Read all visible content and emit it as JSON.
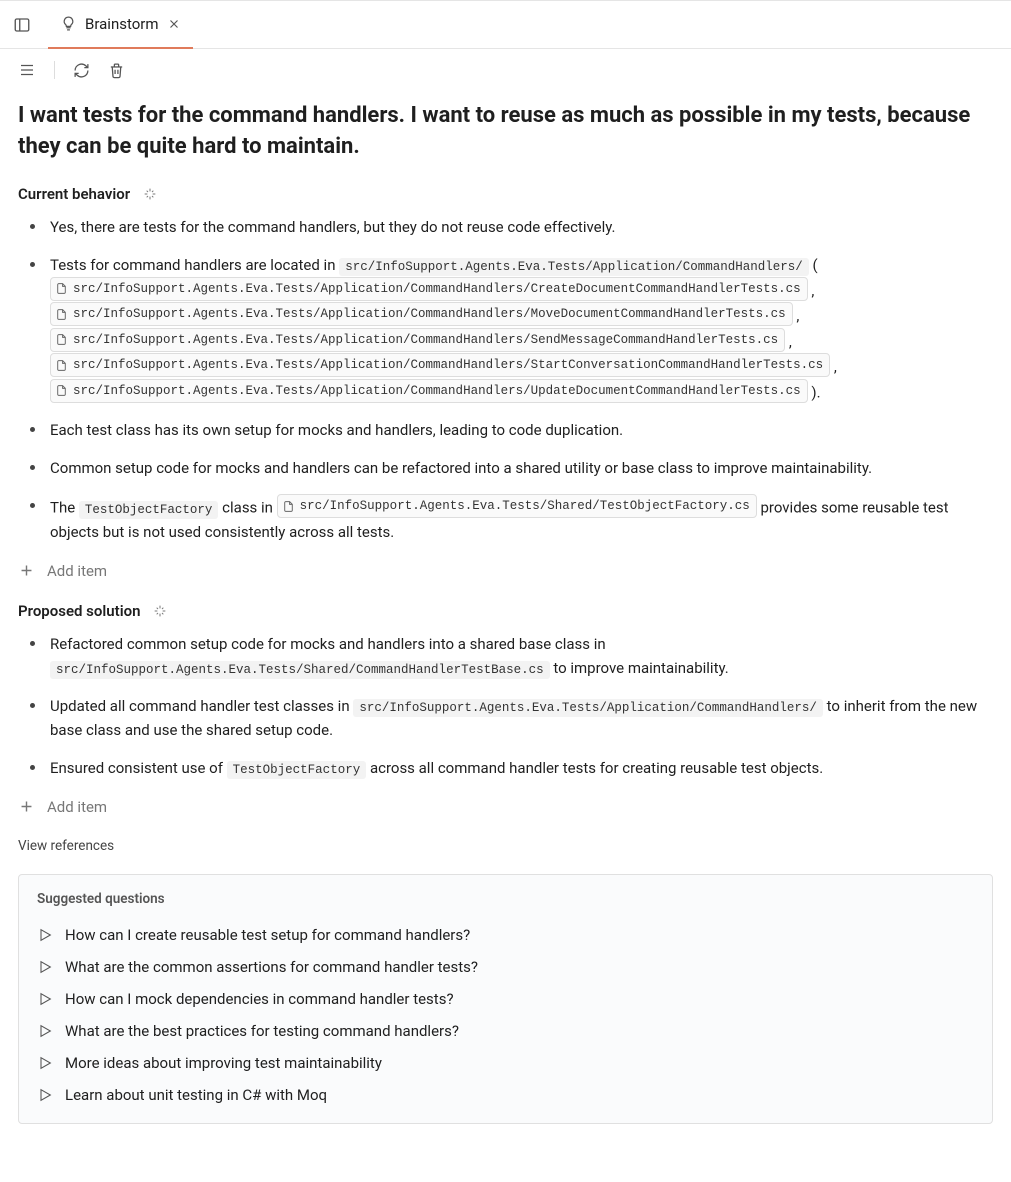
{
  "tab": {
    "title": "Brainstorm"
  },
  "headline": "I want tests for the command handlers. I want to reuse as much as possible in my tests, because they can be quite hard to maintain.",
  "sections": {
    "current": {
      "title": "Current behavior",
      "items": {
        "i0": {
          "text": "Yes, there are tests for the command handlers, but they do not reuse code effectively."
        },
        "i1": {
          "lead": "Tests for command handlers are located in ",
          "dir": "src/InfoSupport.Agents.Eva.Tests/Application/CommandHandlers/",
          "open": " (",
          "sep": " , ",
          "close": " ).",
          "files": [
            "src/InfoSupport.Agents.Eva.Tests/Application/CommandHandlers/CreateDocumentCommandHandlerTests.cs",
            "src/InfoSupport.Agents.Eva.Tests/Application/CommandHandlers/MoveDocumentCommandHandlerTests.cs",
            "src/InfoSupport.Agents.Eva.Tests/Application/CommandHandlers/SendMessageCommandHandlerTests.cs",
            "src/InfoSupport.Agents.Eva.Tests/Application/CommandHandlers/StartConversationCommandHandlerTests.cs",
            "src/InfoSupport.Agents.Eva.Tests/Application/CommandHandlers/UpdateDocumentCommandHandlerTests.cs"
          ]
        },
        "i2": {
          "text": "Each test class has its own setup for mocks and handlers, leading to code duplication."
        },
        "i3": {
          "text": "Common setup code for mocks and handlers can be refactored into a shared utility or base class to improve maintainability."
        },
        "i4": {
          "t0": "The ",
          "c0": "TestObjectFactory",
          "t1": " class in ",
          "f0": "src/InfoSupport.Agents.Eva.Tests/Shared/TestObjectFactory.cs",
          "t2": " provides some reusable test objects but is not used consistently across all tests."
        }
      }
    },
    "proposed": {
      "title": "Proposed solution",
      "items": {
        "p0": {
          "t0": "Refactored common setup code for mocks and handlers into a shared base class in ",
          "c0": "src/InfoSupport.Agents.Eva.Tests/Shared/CommandHandlerTestBase.cs",
          "t1": " to improve maintainability."
        },
        "p1": {
          "t0": "Updated all command handler test classes in ",
          "c0": "src/InfoSupport.Agents.Eva.Tests/Application/CommandHandlers/",
          "t1": " to inherit from the new base class and use the shared setup code."
        },
        "p2": {
          "t0": "Ensured consistent use of ",
          "c0": "TestObjectFactory",
          "t1": " across all command handler tests for creating reusable test objects."
        }
      }
    }
  },
  "add_item_label": "Add item",
  "view_references_label": "View references",
  "suggestions": {
    "title": "Suggested questions",
    "items": [
      "How can I create reusable test setup for command handlers?",
      "What are the common assertions for command handler tests?",
      "How can I mock dependencies in command handler tests?",
      "What are the best practices for testing command handlers?",
      "More ideas about improving test maintainability",
      "Learn about unit testing in C# with Moq"
    ]
  }
}
